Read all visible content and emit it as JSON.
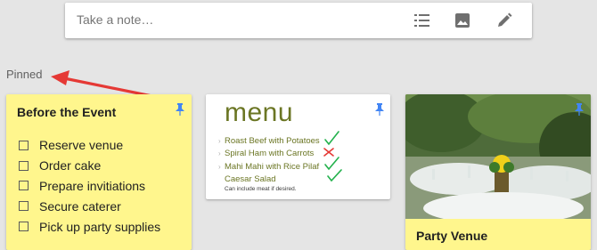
{
  "notebar": {
    "placeholder": "Take a note…",
    "icons": [
      "list-icon",
      "image-icon",
      "pen-icon"
    ]
  },
  "pinned_label": "Pinned",
  "notes": [
    {
      "title": "Before the Event",
      "color": "#fff68d",
      "pinned": true,
      "checklist": [
        "Reserve venue",
        "Order cake",
        "Prepare invitiations",
        "Secure caterer",
        "Pick up party supplies"
      ]
    },
    {
      "color": "#ffffff",
      "pinned": true,
      "image": {
        "heading": "menu",
        "items": [
          "Roast Beef with Potatoes",
          "Spiral Ham with Carrots",
          "Mahi Mahi with Rice Pilaf",
          "Caesar Salad"
        ],
        "note": "Can include meat if desired."
      }
    },
    {
      "title": "Party Venue",
      "color": "#fff68d",
      "pinned": true,
      "image": "outdoor-banquet-photo"
    }
  ],
  "colors": {
    "accent_pin": "#4285f4",
    "annotation_arrow": "#e53935",
    "check_mark": "#22b14c",
    "cross_mark": "#e53935",
    "menu_text": "#6b7624"
  }
}
